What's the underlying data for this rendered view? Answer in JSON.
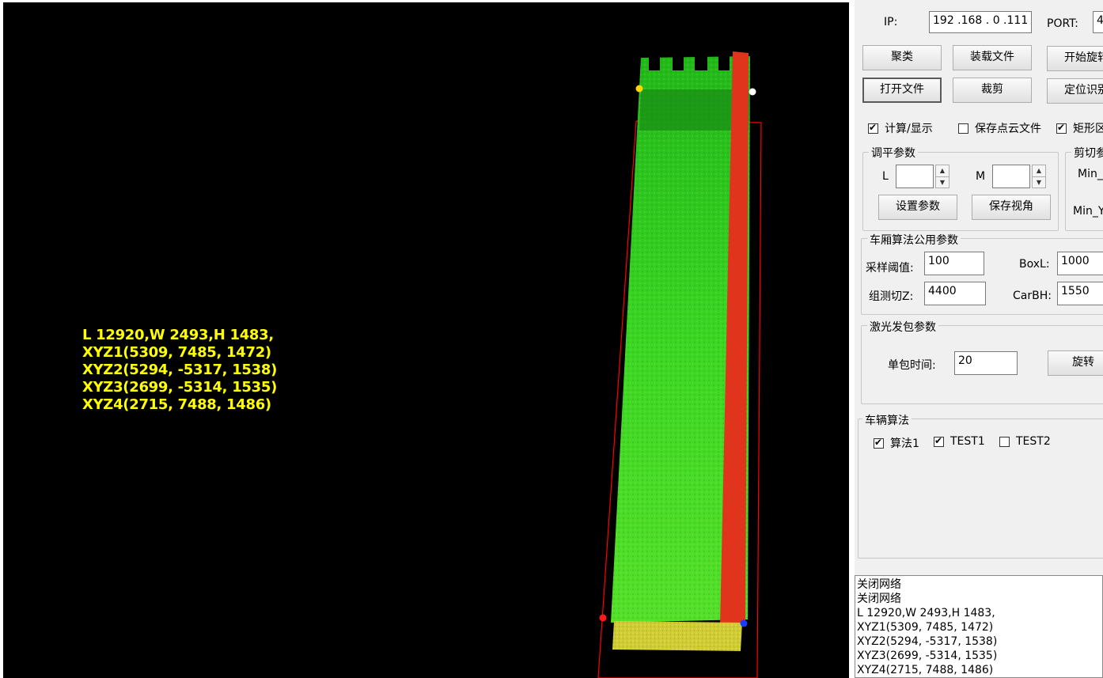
{
  "viewport": {
    "overlay_lines": [
      "L 12920,W 2493,H 1483,",
      "XYZ1(5309, 7485, 1472)",
      "XYZ2(5294, -5317, 1538)",
      "XYZ3(2699, -5314, 1535)",
      "XYZ4(2715, 7488, 1486)"
    ],
    "colors": {
      "background": "#000000",
      "points_green": "#2fd01f",
      "points_red": "#e8301a",
      "points_yellow": "#d6d236",
      "box_line": "#ff0000",
      "text": "#ffff00"
    }
  },
  "connection": {
    "ip_label": "IP:",
    "ip_value": "192 .168 .  0  .111",
    "port_label": "PORT:",
    "port_value": "4"
  },
  "buttons": {
    "cluster": "聚类",
    "load_file": "装载文件",
    "start_rotate": "开始旋转",
    "open_file": "打开文件",
    "crop": "裁剪",
    "locate": "定位识别"
  },
  "checks": {
    "compute_display": {
      "label": "计算/显示",
      "checked": true
    },
    "save_cloud": {
      "label": "保存点云文件",
      "checked": false
    },
    "rect_region": {
      "label": "矩形区",
      "checked": true
    }
  },
  "leveling": {
    "title": "调平参数",
    "l_label": "L",
    "m_label": "M",
    "l_value": "",
    "m_value": "",
    "set_button": "设置参数",
    "save_view_button": "保存视角"
  },
  "crop_params": {
    "title": "剪切参",
    "min_x_label": "Min_X",
    "min_y_label": "Min_Y"
  },
  "carriage": {
    "title": "车厢算法公用参数",
    "sample_label": "采样阈值:",
    "sample_value": "100",
    "boxl_label": "BoxL:",
    "boxl_value": "1000",
    "cutz_label": "组测切Z:",
    "cutz_value": "4400",
    "carbh_label": "CarBH:",
    "carbh_value": "1550"
  },
  "laser": {
    "title": "激光发包参数",
    "time_label": "单包时间:",
    "time_value": "20",
    "rotate_button": "旋转"
  },
  "vehicle": {
    "title": "车辆算法",
    "algo1": {
      "label": "算法1",
      "checked": true
    },
    "test1": {
      "label": "TEST1",
      "checked": true
    },
    "test2": {
      "label": "TEST2",
      "checked": false
    }
  },
  "log": [
    "关闭网络",
    "关闭网络",
    "L 12920,W 2493,H 1483,",
    "XYZ1(5309, 7485, 1472)",
    "XYZ2(5294, -5317, 1538)",
    "XYZ3(2699, -5314, 1535)",
    "XYZ4(2715, 7488, 1486)"
  ]
}
